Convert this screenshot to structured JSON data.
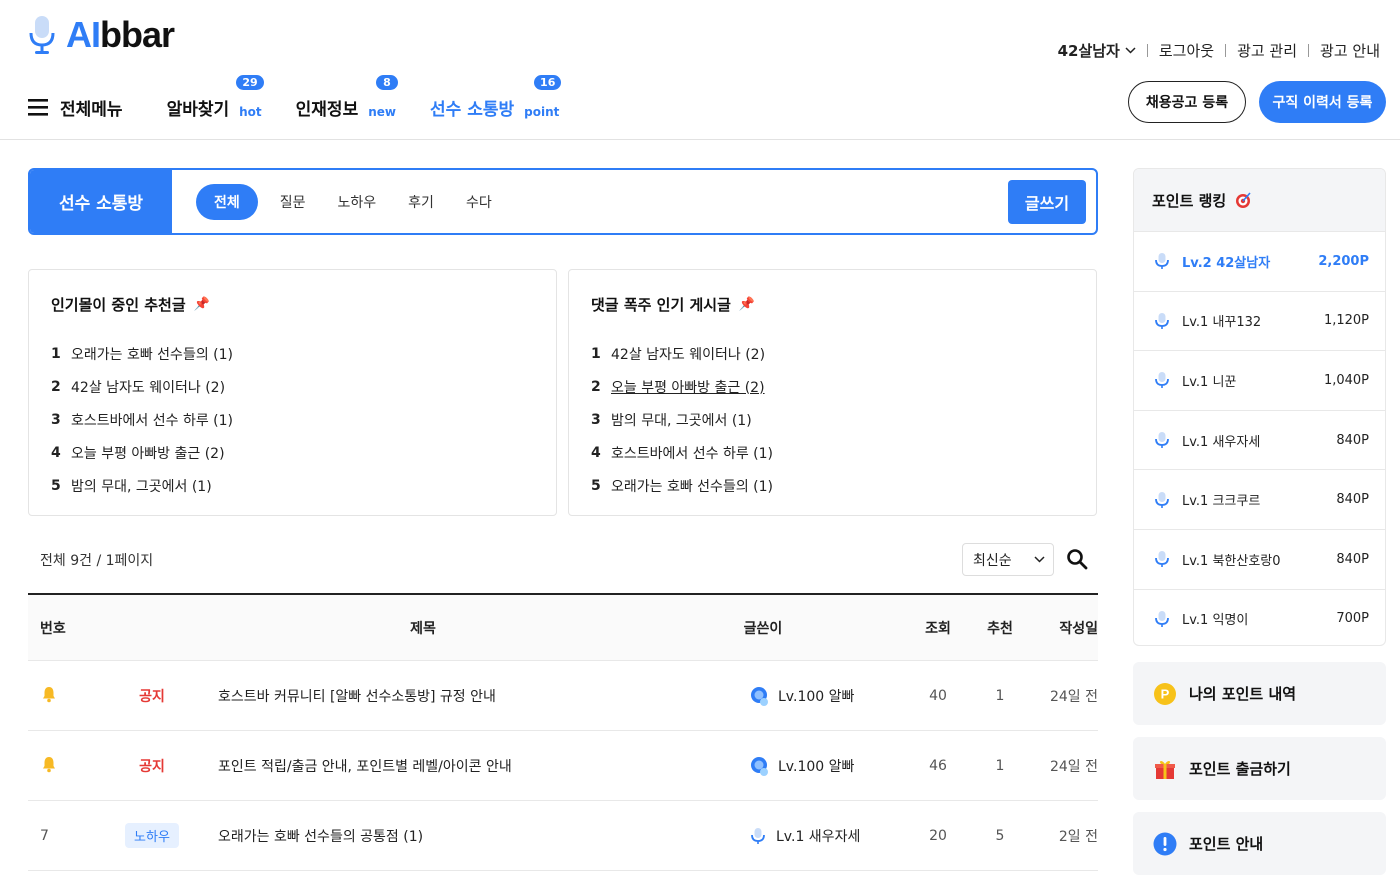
{
  "header": {
    "logo_ai": "AI",
    "logo_rest": "bbar",
    "user_menu": "42살남자",
    "links": [
      "로그아웃",
      "광고 관리",
      "광고 안내"
    ],
    "all_menu": "전체메뉴",
    "nav": [
      {
        "label": "알바찾기",
        "sub": "hot",
        "badge": "29"
      },
      {
        "label": "인재정보",
        "sub": "new",
        "badge": "8"
      },
      {
        "label": "선수 소통방",
        "sub": "point",
        "badge": "16"
      }
    ],
    "btn_job_post": "채용공고 등록",
    "btn_resume": "구직 이력서 등록"
  },
  "board": {
    "title": "선수 소통방",
    "tabs": [
      "전체",
      "질문",
      "노하우",
      "후기",
      "수다"
    ],
    "write": "글쓰기"
  },
  "popular": {
    "title": "인기몰이 중인 추천글",
    "items": [
      {
        "n": "1",
        "t": "오래가는 호빠 선수들의 (1)"
      },
      {
        "n": "2",
        "t": "42살 남자도 웨이터나 (2)"
      },
      {
        "n": "3",
        "t": "호스트바에서 선수 하루 (1)"
      },
      {
        "n": "4",
        "t": "오늘 부평 아빠방 출근 (2)"
      },
      {
        "n": "5",
        "t": "밤의 무대, 그곳에서 (1)"
      }
    ]
  },
  "hot_comments": {
    "title": "댓글 폭주 인기 게시글",
    "items": [
      {
        "n": "1",
        "t": "42살 남자도 웨이터나 (2)"
      },
      {
        "n": "2",
        "t": "오늘 부평 아빠방 출근 (2)"
      },
      {
        "n": "3",
        "t": "밤의 무대, 그곳에서 (1)"
      },
      {
        "n": "4",
        "t": "호스트바에서 선수 하루 (1)"
      },
      {
        "n": "5",
        "t": "오래가는 호빠 선수들의 (1)"
      }
    ]
  },
  "list": {
    "count": "전체 9건 / 1페이지",
    "sort": "최신순",
    "headers": {
      "num": "번호",
      "title": "제목",
      "author": "글쓴이",
      "views": "조회",
      "likes": "추천",
      "date": "작성일"
    },
    "rows": [
      {
        "num": "",
        "cat": "공지",
        "title": "호스트바 커뮤니티 [알빠 선수소통방] 규정 안내",
        "author": "Lv.100  알빠",
        "views": "40",
        "likes": "1",
        "date": "24일 전"
      },
      {
        "num": "",
        "cat": "공지",
        "title": "포인트 적립/출금 안내, 포인트별 레벨/아이콘 안내",
        "author": "Lv.100  알빠",
        "views": "46",
        "likes": "1",
        "date": "24일 전"
      },
      {
        "num": "7",
        "cat": "노하우",
        "title": "오래가는 호빠 선수들의 공통점  (1)",
        "author": "Lv.1  새우자세",
        "views": "20",
        "likes": "5",
        "date": "2일 전"
      }
    ]
  },
  "ranking": {
    "title": "포인트 랭킹",
    "items": [
      {
        "name": "Lv.2 42살남자",
        "pts": "2,200P"
      },
      {
        "name": "Lv.1 내꾸132",
        "pts": "1,120P"
      },
      {
        "name": "Lv.1 니꾼",
        "pts": "1,040P"
      },
      {
        "name": "Lv.1 새우자세",
        "pts": "840P"
      },
      {
        "name": "Lv.1 크크쿠르",
        "pts": "840P"
      },
      {
        "name": "Lv.1 북한산호랑0",
        "pts": "840P"
      },
      {
        "name": "Lv.1 익명이",
        "pts": "700P"
      }
    ]
  },
  "side": {
    "my_points": "나의 포인트 내역",
    "withdraw": "포인트 출금하기",
    "guide": "포인트 안내",
    "p_letter": "P"
  },
  "colors": {
    "accent": "#2f7df6",
    "notice": "#e53935"
  }
}
